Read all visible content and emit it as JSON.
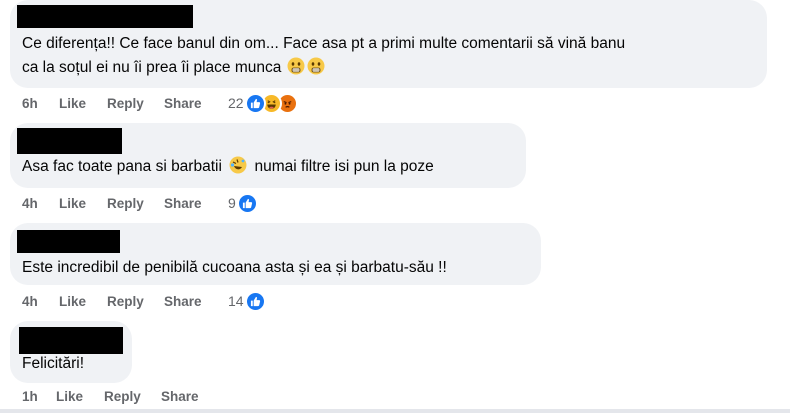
{
  "comments": [
    {
      "text_line1": "Ce diferența!! Ce face banul din om... Face asa pt a primi multe comentarii să vină banu",
      "text_line2": "ca la soțul ei nu îi prea îi place munca",
      "time": "6h",
      "like": "Like",
      "reply": "Reply",
      "share": "Share",
      "reaction_count": "22",
      "reactions": [
        "like-icon",
        "haha-icon",
        "angry-icon"
      ]
    },
    {
      "text_before": "Asa fac toate pana si barbatii",
      "text_after": "numai filtre isi pun la poze",
      "time": "4h",
      "like": "Like",
      "reply": "Reply",
      "share": "Share",
      "reaction_count": "9",
      "reactions": [
        "like-icon"
      ]
    },
    {
      "text": "Este incredibil de penibilă cucoana asta și ea și barbatu-său !!",
      "time": "4h",
      "like": "Like",
      "reply": "Reply",
      "share": "Share",
      "reaction_count": "14",
      "reactions": [
        "like-icon"
      ]
    },
    {
      "text": "Felicitări!",
      "time": "1h",
      "like": "Like",
      "reply": "Reply",
      "share": "Share"
    }
  ],
  "colors": {
    "bubble": "#f0f2f5",
    "meta": "#65676b",
    "like_blue": "#1877f2",
    "haha_yellow": "#f7b928",
    "angry_red": "#e9710f"
  }
}
